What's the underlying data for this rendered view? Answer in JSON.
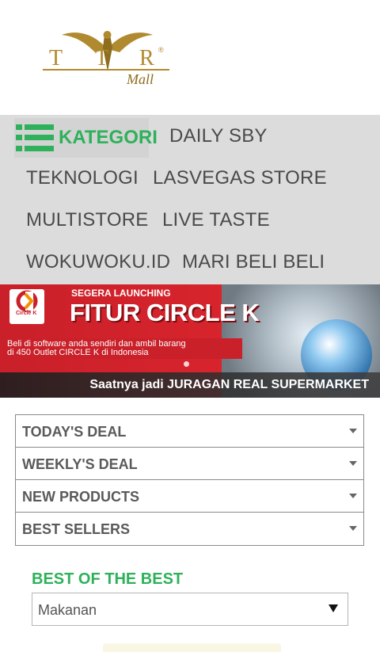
{
  "logo": {
    "letters": "TTR",
    "registered": "®",
    "tagline": "Mall",
    "gold": "#b08a2e"
  },
  "nav": {
    "kategori_label": "KATEGORI",
    "items": [
      {
        "label": "DAILY SBY"
      },
      {
        "label": "TEKNOLOGI"
      },
      {
        "label": "LASVEGAS STORE"
      },
      {
        "label": "MULTISTORE"
      },
      {
        "label": "LIVE TASTE"
      },
      {
        "label": "WOKUWOKU.ID"
      },
      {
        "label": "MARI BELI BELI"
      }
    ],
    "accent": "#2eb15a"
  },
  "banner": {
    "brand_label": "Circle K",
    "launch": "SEGERA LAUNCHING",
    "headline": "FITUR CIRCLE K",
    "description_line1": "Beli di software anda sendiri dan ambil barang",
    "description_line2": "di 450 Outlet CIRCLE K di Indonesia",
    "footer": "Saatnya jadi JURAGAN REAL SUPERMARKET",
    "red": "#c9202a"
  },
  "deals": [
    {
      "label": "TODAY'S DEAL"
    },
    {
      "label": "WEEKLY'S DEAL"
    },
    {
      "label": "NEW PRODUCTS"
    },
    {
      "label": "BEST SELLERS"
    }
  ],
  "best": {
    "title": "BEST OF THE BEST",
    "selected": "Makanan"
  }
}
